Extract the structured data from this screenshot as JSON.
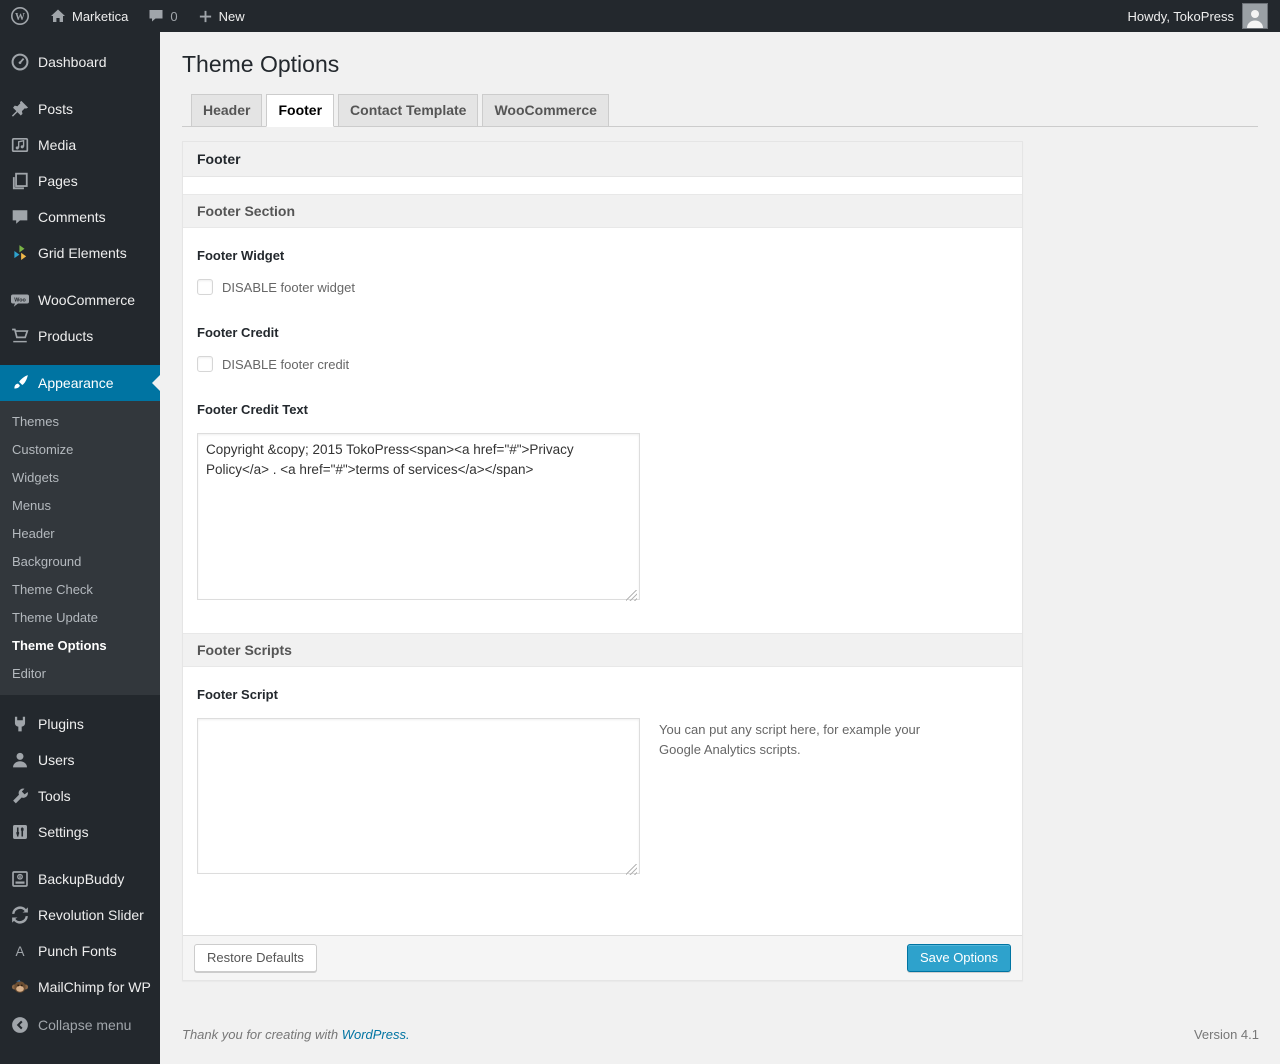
{
  "admin_bar": {
    "site_name": "Marketica",
    "comment_count": "0",
    "new_label": "New",
    "howdy": "Howdy, TokoPress",
    "icons": [
      "wordpress-logo-icon",
      "home-icon",
      "comment-bubble-icon",
      "plus-icon",
      "avatar"
    ]
  },
  "sidebar": {
    "groups": [
      {
        "items": [
          {
            "id": "dashboard",
            "label": "Dashboard",
            "icon": "dashboard-icon"
          }
        ]
      },
      {
        "items": [
          {
            "id": "posts",
            "label": "Posts",
            "icon": "pin-icon"
          },
          {
            "id": "media",
            "label": "Media",
            "icon": "media-icon"
          },
          {
            "id": "pages",
            "label": "Pages",
            "icon": "pages-icon"
          },
          {
            "id": "comments",
            "label": "Comments",
            "icon": "comments-icon"
          },
          {
            "id": "grid-elements",
            "label": "Grid Elements",
            "icon": "grid-elements-icon"
          }
        ]
      },
      {
        "items": [
          {
            "id": "woocommerce",
            "label": "WooCommerce",
            "icon": "woocommerce-icon"
          },
          {
            "id": "products",
            "label": "Products",
            "icon": "cart-icon"
          }
        ]
      },
      {
        "items": [
          {
            "id": "appearance",
            "label": "Appearance",
            "icon": "brush-icon",
            "active": true,
            "submenu": [
              {
                "label": "Themes"
              },
              {
                "label": "Customize"
              },
              {
                "label": "Widgets"
              },
              {
                "label": "Menus"
              },
              {
                "label": "Header"
              },
              {
                "label": "Background"
              },
              {
                "label": "Theme Check"
              },
              {
                "label": "Theme Update"
              },
              {
                "label": "Theme Options",
                "current": true
              },
              {
                "label": "Editor"
              }
            ]
          }
        ]
      },
      {
        "items": [
          {
            "id": "plugins",
            "label": "Plugins",
            "icon": "plug-icon"
          },
          {
            "id": "users",
            "label": "Users",
            "icon": "user-icon"
          },
          {
            "id": "tools",
            "label": "Tools",
            "icon": "wrench-icon"
          },
          {
            "id": "settings",
            "label": "Settings",
            "icon": "sliders-icon"
          }
        ]
      },
      {
        "items": [
          {
            "id": "backupbuddy",
            "label": "BackupBuddy",
            "icon": "backup-icon"
          },
          {
            "id": "revolution-slider",
            "label": "Revolution Slider",
            "icon": "cycle-icon"
          },
          {
            "id": "punch-fonts",
            "label": "Punch Fonts",
            "icon": "letter-a-icon"
          },
          {
            "id": "mailchimp-for-wp",
            "label": "MailChimp for WP",
            "icon": "monkey-icon"
          }
        ]
      },
      {
        "items": [
          {
            "id": "collapse-menu",
            "label": "Collapse menu",
            "icon": "collapse-icon",
            "muted": true
          }
        ],
        "small_gap": true
      }
    ]
  },
  "page": {
    "title": "Theme Options",
    "tabs": [
      {
        "label": "Header",
        "active": false
      },
      {
        "label": "Footer",
        "active": true
      },
      {
        "label": "Contact Template",
        "active": false
      },
      {
        "label": "WooCommerce",
        "active": false
      }
    ],
    "panel": {
      "header_title": "Footer",
      "section1_title": "Footer Section",
      "footer_widget_label": "Footer Widget",
      "footer_widget_checkbox_label": "DISABLE footer widget",
      "footer_widget_checked": false,
      "footer_credit_label": "Footer Credit",
      "footer_credit_checkbox_label": "DISABLE footer credit",
      "footer_credit_checked": false,
      "footer_credit_text_label": "Footer Credit Text",
      "footer_credit_text_value": "Copyright &copy; 2015 TokoPress<span><a href=\"#\">Privacy Policy</a> . <a href=\"#\">terms of services</a></span>",
      "section2_title": "Footer Scripts",
      "footer_script_label": "Footer Script",
      "footer_script_value": "",
      "footer_script_help": "You can put any script here, for example your Google Analytics scripts.",
      "restore_button_label": "Restore Defaults",
      "save_button_label": "Save Options"
    }
  },
  "footer": {
    "thanks_prefix": "Thank you for creating with ",
    "thanks_link": "WordPress.",
    "version": "Version 4.1"
  },
  "colors": {
    "admin_bar_bg": "#23282d",
    "sidebar_bg": "#23282d",
    "submenu_bg": "#32373c",
    "menu_highlight": "#0074a2",
    "primary_button": "#2ea2cc",
    "link": "#0074a2",
    "page_bg": "#f1f1f1"
  }
}
